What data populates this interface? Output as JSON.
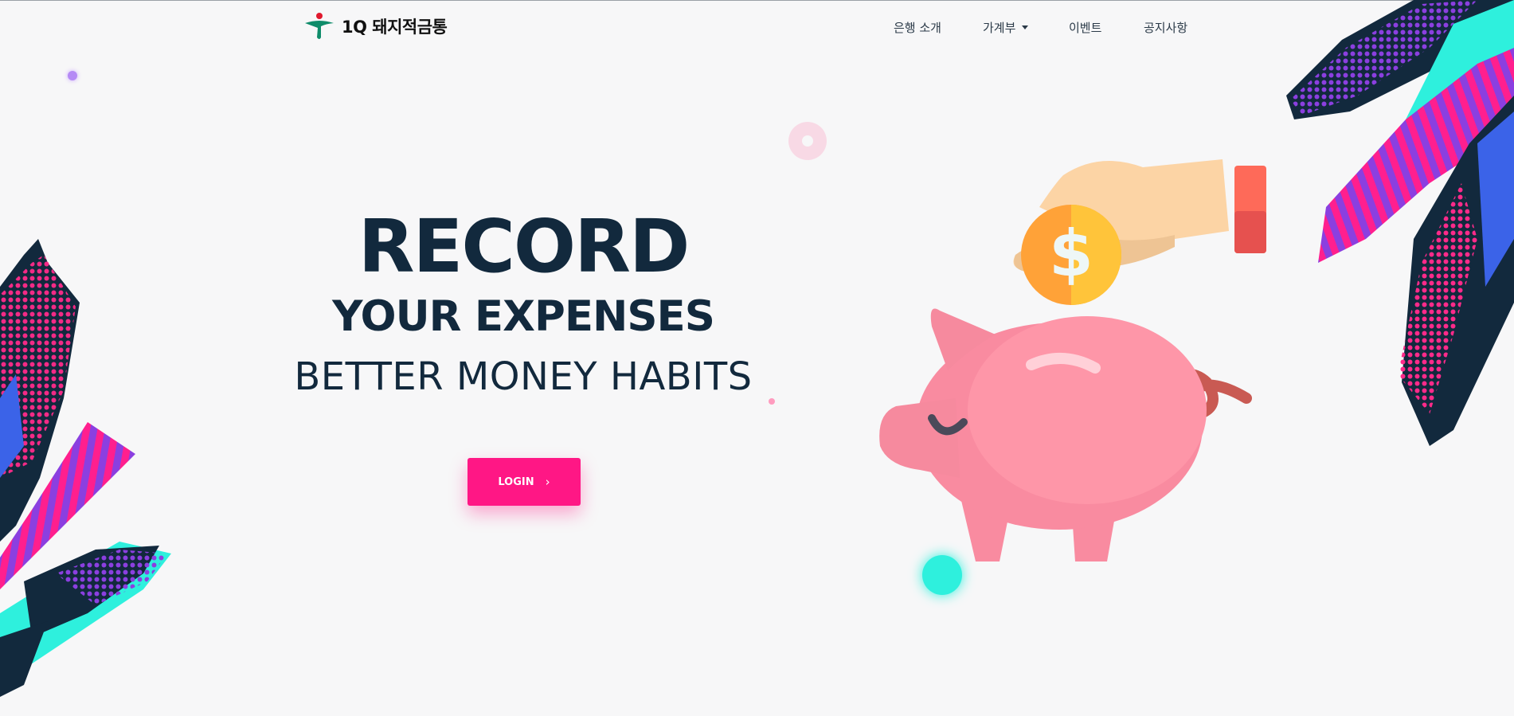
{
  "header": {
    "brand": "1Q 돼지적금통",
    "nav": [
      {
        "label": "은행 소개"
      },
      {
        "label": "가계부",
        "has_dropdown": true
      },
      {
        "label": "이벤트"
      },
      {
        "label": "공지사항"
      }
    ]
  },
  "hero": {
    "line1": "RECORD",
    "line2": "YOUR EXPENSES",
    "line3": "BETTER MONEY HABITS",
    "login_label": "LOGIN",
    "login_icon": "chevron-right-icon"
  },
  "illustration": {
    "subject": "piggy-bank-coin-hand",
    "coin_symbol": "$"
  },
  "colors": {
    "accent": "#ff1785",
    "text_dark": "#12293d",
    "background": "#f7f7f8",
    "cyan": "#2ef0dd",
    "purple": "#8b3fe0",
    "pig": "#fb8fa3"
  }
}
